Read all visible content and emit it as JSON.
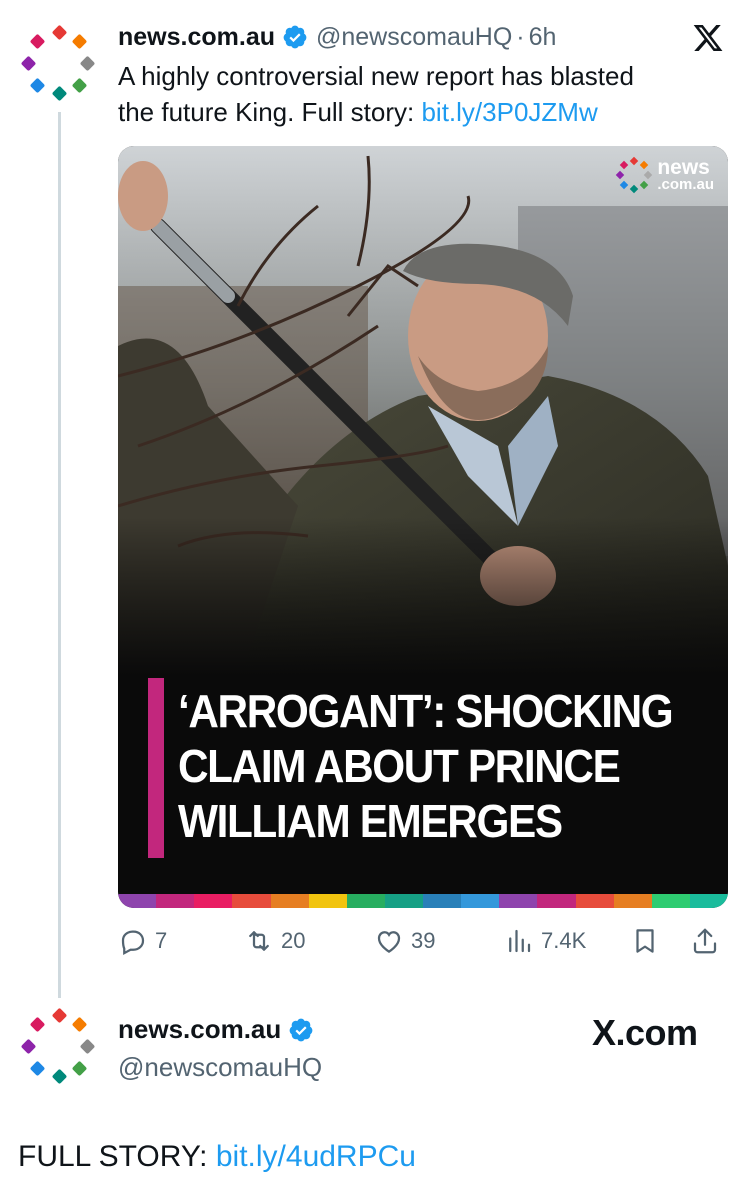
{
  "tweet": {
    "display_name": "news.com.au",
    "handle": "@newscomauHQ",
    "separator": "·",
    "time": "6h",
    "text_line1": "A highly controversial new report has blasted",
    "text_line2_prefix": "the future King. Full story: ",
    "link": "bit.ly/3P0JZMw",
    "verified_icon": "verified-badge-icon",
    "platform_icon": "x-logo-icon"
  },
  "media": {
    "logo_text": "news",
    "logo_sub": ".com.au",
    "headline_line1": "‘ARROGANT’: SHOCKING",
    "headline_line2": "CLAIM ABOUT PRINCE",
    "headline_line3": "WILLIAM EMERGES",
    "accent_color": "#c2277d",
    "strip_colors": [
      "#8e44ad",
      "#c2277d",
      "#e91e63",
      "#e74c3c",
      "#e67e22",
      "#f1c40f",
      "#27ae60",
      "#16a085",
      "#2980b9",
      "#3498db",
      "#8e44ad",
      "#c2277d",
      "#e74c3c",
      "#e67e22",
      "#2ecc71",
      "#1abc9c"
    ]
  },
  "actions": {
    "replies": "7",
    "retweets": "20",
    "likes": "39",
    "views": "7.4K"
  },
  "card": {
    "display_name": "news.com.au",
    "handle": "@newscomauHQ",
    "brand": "X.com"
  },
  "footer": {
    "prefix": "FULL STORY: ",
    "link": "bit.ly/4udRPCu"
  },
  "colors": {
    "link": "#1d9bf0",
    "muted": "#536471",
    "verified": "#1d9bf0"
  }
}
